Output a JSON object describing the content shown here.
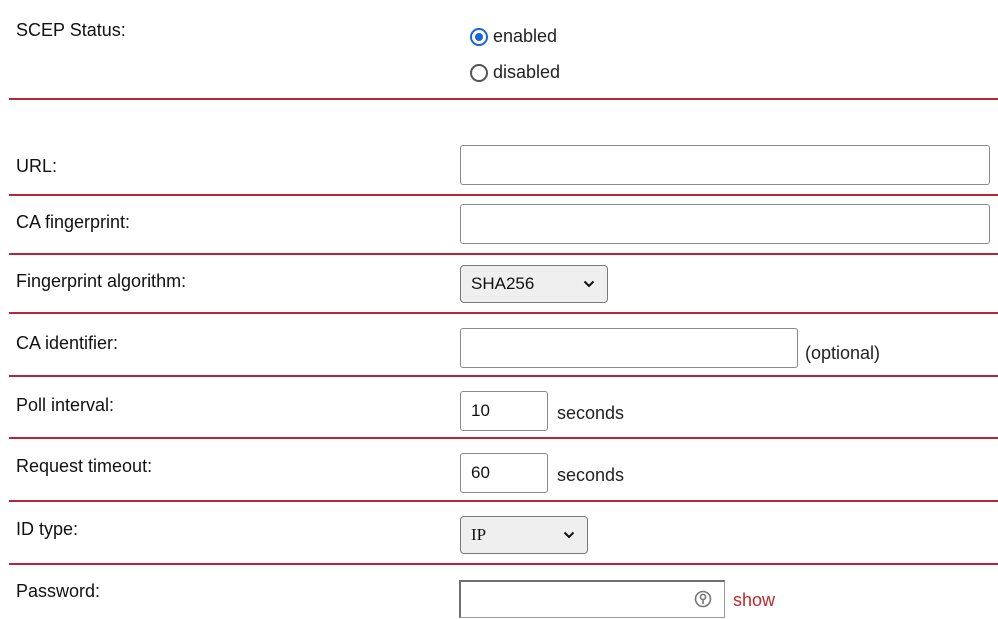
{
  "scep_status": {
    "label": "SCEP Status:",
    "options": [
      {
        "label": "enabled",
        "checked": true
      },
      {
        "label": "disabled",
        "checked": false
      }
    ]
  },
  "url": {
    "label": "URL:",
    "value": ""
  },
  "ca_fingerprint": {
    "label": "CA fingerprint:",
    "value": ""
  },
  "fingerprint_algorithm": {
    "label": "Fingerprint algorithm:",
    "selected": "SHA256"
  },
  "ca_identifier": {
    "label": "CA identifier:",
    "value": "",
    "suffix": "(optional)"
  },
  "poll_interval": {
    "label": "Poll interval:",
    "value": "10",
    "suffix": "seconds"
  },
  "request_timeout": {
    "label": "Request timeout:",
    "value": "60",
    "suffix": "seconds"
  },
  "id_type": {
    "label": "ID type:",
    "selected": "IP"
  },
  "password": {
    "label": "Password:",
    "value": "",
    "show_label": "show"
  },
  "colors": {
    "divider": "#b3273d",
    "radio_accent": "#1a64d8",
    "link": "#c1272d"
  },
  "icons": {
    "select_arrow": "chevron-down-icon",
    "password_field": "key-icon"
  }
}
